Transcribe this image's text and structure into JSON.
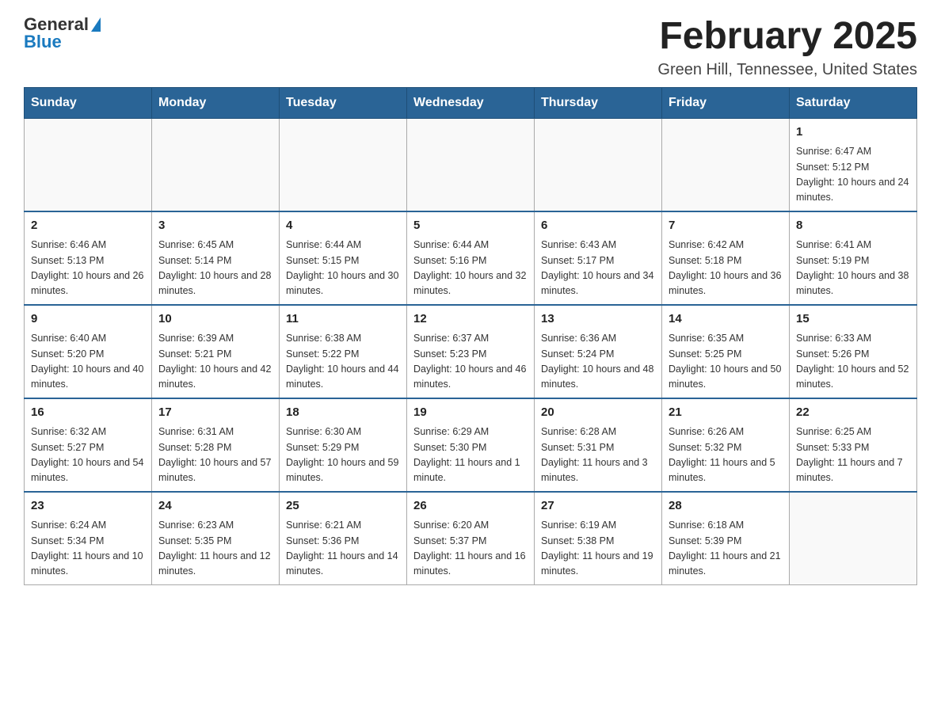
{
  "logo": {
    "general": "General",
    "blue": "Blue"
  },
  "title": "February 2025",
  "subtitle": "Green Hill, Tennessee, United States",
  "weekdays": [
    "Sunday",
    "Monday",
    "Tuesday",
    "Wednesday",
    "Thursday",
    "Friday",
    "Saturday"
  ],
  "weeks": [
    [
      {
        "day": "",
        "info": ""
      },
      {
        "day": "",
        "info": ""
      },
      {
        "day": "",
        "info": ""
      },
      {
        "day": "",
        "info": ""
      },
      {
        "day": "",
        "info": ""
      },
      {
        "day": "",
        "info": ""
      },
      {
        "day": "1",
        "info": "Sunrise: 6:47 AM\nSunset: 5:12 PM\nDaylight: 10 hours and 24 minutes."
      }
    ],
    [
      {
        "day": "2",
        "info": "Sunrise: 6:46 AM\nSunset: 5:13 PM\nDaylight: 10 hours and 26 minutes."
      },
      {
        "day": "3",
        "info": "Sunrise: 6:45 AM\nSunset: 5:14 PM\nDaylight: 10 hours and 28 minutes."
      },
      {
        "day": "4",
        "info": "Sunrise: 6:44 AM\nSunset: 5:15 PM\nDaylight: 10 hours and 30 minutes."
      },
      {
        "day": "5",
        "info": "Sunrise: 6:44 AM\nSunset: 5:16 PM\nDaylight: 10 hours and 32 minutes."
      },
      {
        "day": "6",
        "info": "Sunrise: 6:43 AM\nSunset: 5:17 PM\nDaylight: 10 hours and 34 minutes."
      },
      {
        "day": "7",
        "info": "Sunrise: 6:42 AM\nSunset: 5:18 PM\nDaylight: 10 hours and 36 minutes."
      },
      {
        "day": "8",
        "info": "Sunrise: 6:41 AM\nSunset: 5:19 PM\nDaylight: 10 hours and 38 minutes."
      }
    ],
    [
      {
        "day": "9",
        "info": "Sunrise: 6:40 AM\nSunset: 5:20 PM\nDaylight: 10 hours and 40 minutes."
      },
      {
        "day": "10",
        "info": "Sunrise: 6:39 AM\nSunset: 5:21 PM\nDaylight: 10 hours and 42 minutes."
      },
      {
        "day": "11",
        "info": "Sunrise: 6:38 AM\nSunset: 5:22 PM\nDaylight: 10 hours and 44 minutes."
      },
      {
        "day": "12",
        "info": "Sunrise: 6:37 AM\nSunset: 5:23 PM\nDaylight: 10 hours and 46 minutes."
      },
      {
        "day": "13",
        "info": "Sunrise: 6:36 AM\nSunset: 5:24 PM\nDaylight: 10 hours and 48 minutes."
      },
      {
        "day": "14",
        "info": "Sunrise: 6:35 AM\nSunset: 5:25 PM\nDaylight: 10 hours and 50 minutes."
      },
      {
        "day": "15",
        "info": "Sunrise: 6:33 AM\nSunset: 5:26 PM\nDaylight: 10 hours and 52 minutes."
      }
    ],
    [
      {
        "day": "16",
        "info": "Sunrise: 6:32 AM\nSunset: 5:27 PM\nDaylight: 10 hours and 54 minutes."
      },
      {
        "day": "17",
        "info": "Sunrise: 6:31 AM\nSunset: 5:28 PM\nDaylight: 10 hours and 57 minutes."
      },
      {
        "day": "18",
        "info": "Sunrise: 6:30 AM\nSunset: 5:29 PM\nDaylight: 10 hours and 59 minutes."
      },
      {
        "day": "19",
        "info": "Sunrise: 6:29 AM\nSunset: 5:30 PM\nDaylight: 11 hours and 1 minute."
      },
      {
        "day": "20",
        "info": "Sunrise: 6:28 AM\nSunset: 5:31 PM\nDaylight: 11 hours and 3 minutes."
      },
      {
        "day": "21",
        "info": "Sunrise: 6:26 AM\nSunset: 5:32 PM\nDaylight: 11 hours and 5 minutes."
      },
      {
        "day": "22",
        "info": "Sunrise: 6:25 AM\nSunset: 5:33 PM\nDaylight: 11 hours and 7 minutes."
      }
    ],
    [
      {
        "day": "23",
        "info": "Sunrise: 6:24 AM\nSunset: 5:34 PM\nDaylight: 11 hours and 10 minutes."
      },
      {
        "day": "24",
        "info": "Sunrise: 6:23 AM\nSunset: 5:35 PM\nDaylight: 11 hours and 12 minutes."
      },
      {
        "day": "25",
        "info": "Sunrise: 6:21 AM\nSunset: 5:36 PM\nDaylight: 11 hours and 14 minutes."
      },
      {
        "day": "26",
        "info": "Sunrise: 6:20 AM\nSunset: 5:37 PM\nDaylight: 11 hours and 16 minutes."
      },
      {
        "day": "27",
        "info": "Sunrise: 6:19 AM\nSunset: 5:38 PM\nDaylight: 11 hours and 19 minutes."
      },
      {
        "day": "28",
        "info": "Sunrise: 6:18 AM\nSunset: 5:39 PM\nDaylight: 11 hours and 21 minutes."
      },
      {
        "day": "",
        "info": ""
      }
    ]
  ]
}
